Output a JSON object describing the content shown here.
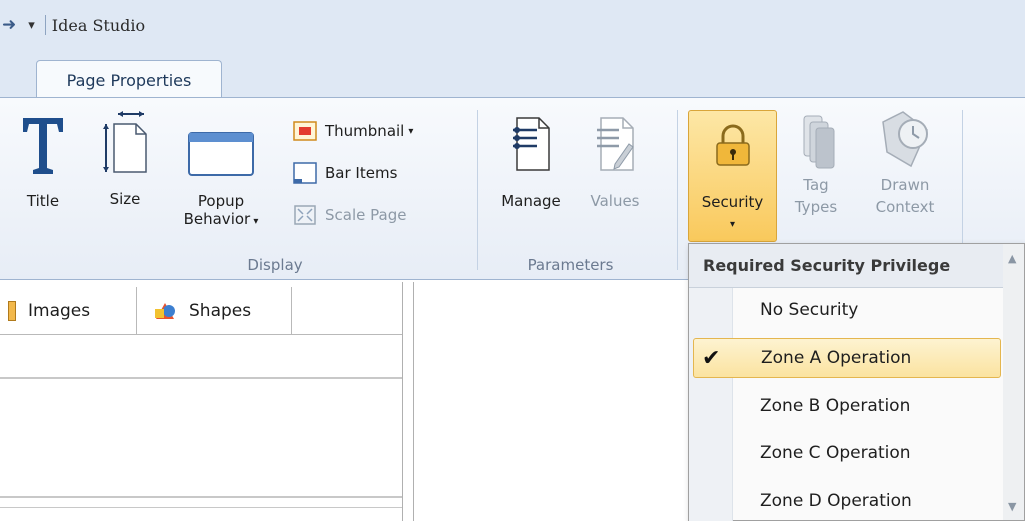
{
  "app": {
    "title": "Idea Studio"
  },
  "tabs": {
    "active": "Page Properties"
  },
  "ribbon": {
    "display": {
      "title": "Title",
      "size": "Size",
      "popup_line1": "Popup",
      "popup_line2": "Behavior",
      "thumbnail": "Thumbnail",
      "bar_items": "Bar Items",
      "scale_page": "Scale Page",
      "group_label": "Display"
    },
    "parameters": {
      "manage": "Manage",
      "values": "Values",
      "group_label": "Parameters"
    },
    "security": {
      "security": "Security",
      "tag_line1": "Tag",
      "tag_line2": "Types",
      "drawn_line1": "Drawn",
      "drawn_line2": "Context"
    }
  },
  "panel_tabs": {
    "images": "Images",
    "shapes": "Shapes"
  },
  "security_menu": {
    "header": "Required Security Privilege",
    "items": [
      "No Security",
      "Zone A Operation",
      "Zone B Operation",
      "Zone C Operation",
      "Zone D Operation"
    ],
    "selected": "Zone A Operation"
  },
  "colors": {
    "ribbon_bg": "#e7edf6",
    "accent": "#f9c95c",
    "title_bar": "#dfe8f4"
  }
}
